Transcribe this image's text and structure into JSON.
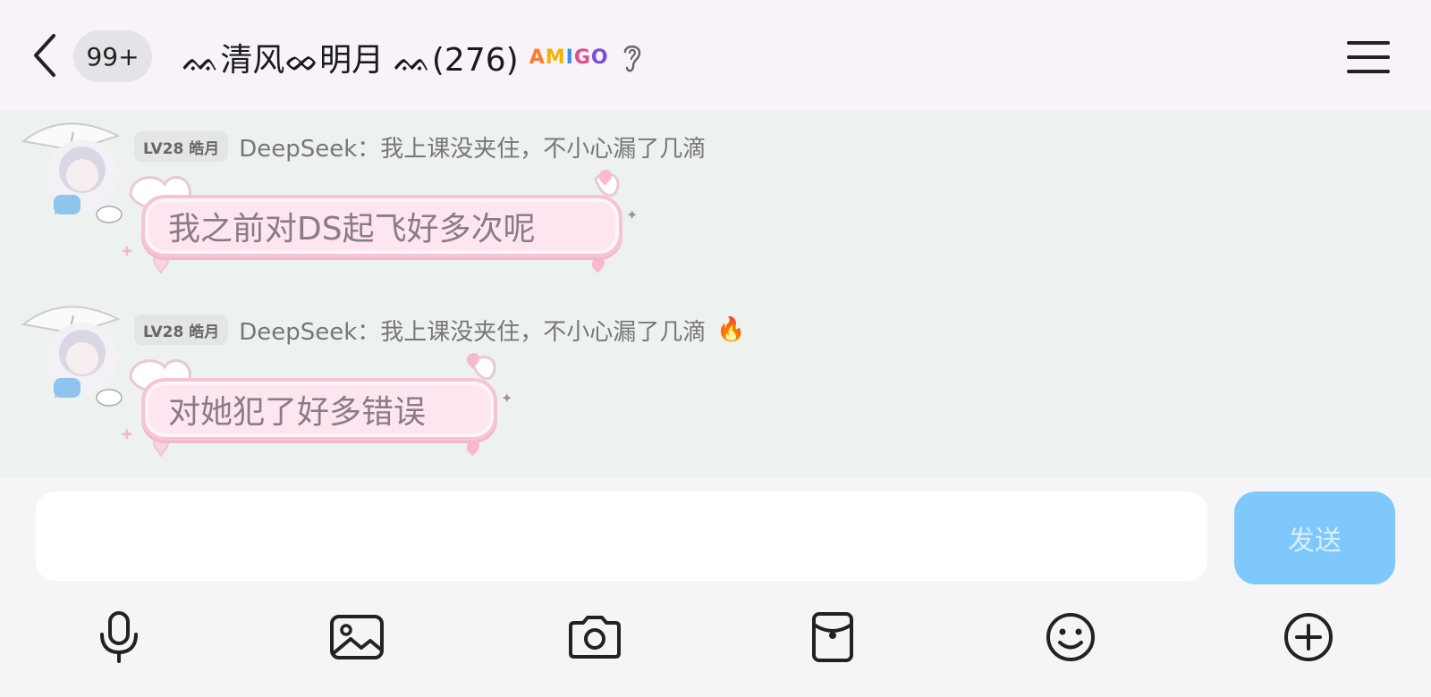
{
  "header": {
    "back_label": "back",
    "unread_count": "99+",
    "chat_title": "ᨐ清风ᨖ明月 ᨐ(276)",
    "badge_text": [
      "A",
      "M",
      "I",
      "G",
      "O"
    ],
    "menu_label": "menu"
  },
  "messages": [
    {
      "level": "LV28 皓月",
      "sender_line": "DeepSeek：我上课没夹住，不小心漏了几滴",
      "text": "我之前对DS起飞好多次呢",
      "has_fire": false
    },
    {
      "level": "LV28 皓月",
      "sender_line": "DeepSeek：我上课没夹住，不小心漏了几滴",
      "text": "对她犯了好多错误",
      "has_fire": true,
      "fire_glyph": "🔥"
    }
  ],
  "composer": {
    "input_value": "",
    "send_label": "发送"
  },
  "toolbar": [
    "microphone-icon",
    "image-icon",
    "camera-icon",
    "red-packet-icon",
    "emoji-icon",
    "plus-icon"
  ],
  "colors": {
    "header_bg": "#f7f3f8",
    "messages_bg": "#eef2ef",
    "bubble_bg": "#fde6ef",
    "send_bg": "#7ec8fb"
  }
}
